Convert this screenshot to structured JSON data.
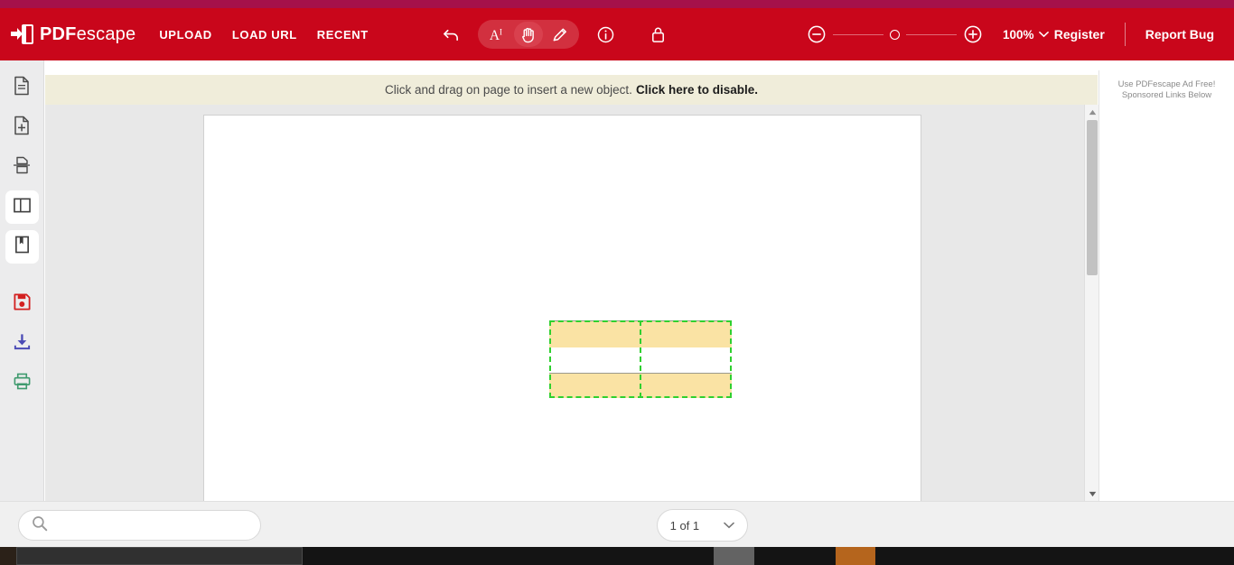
{
  "header": {
    "brand": {
      "pdf": "PDF",
      "escape": "escape",
      "icon": "pdfescape-logo-icon"
    },
    "nav": [
      {
        "label": "UPLOAD",
        "name": "nav-upload"
      },
      {
        "label": "LOAD URL",
        "name": "nav-load-url"
      },
      {
        "label": "RECENT",
        "name": "nav-recent"
      }
    ],
    "tools": [
      {
        "name": "undo-icon",
        "title": "Undo",
        "active": false
      },
      {
        "name": "text-tool-icon",
        "title": "Text Tool",
        "active": false
      },
      {
        "name": "hand-tool-icon",
        "title": "Hand Tool",
        "active": true
      },
      {
        "name": "pencil-tool-icon",
        "title": "Draw Tool",
        "active": false
      },
      {
        "name": "info-icon",
        "title": "Info",
        "active": false
      },
      {
        "name": "lock-icon",
        "title": "Lock",
        "active": false
      }
    ],
    "zoom": {
      "minus_icon": "zoom-out-icon",
      "plus_icon": "zoom-in-icon",
      "level": "100%",
      "chevron": "chevron-down-icon"
    },
    "register_label": "Register",
    "report_bug_label": "Report Bug",
    "accent_color": "#c9061b",
    "top_strip_color": "#a5114a"
  },
  "sidebar": {
    "items": [
      {
        "name": "sidebar-page-view",
        "icon": "document-icon",
        "active": false
      },
      {
        "name": "sidebar-insert-page",
        "icon": "add-page-icon",
        "active": false
      },
      {
        "name": "sidebar-split-page",
        "icon": "split-page-icon",
        "active": false
      },
      {
        "name": "sidebar-panel-layout",
        "icon": "panel-layout-icon",
        "active": true
      },
      {
        "name": "sidebar-bookmarks",
        "icon": "bookmark-page-icon",
        "active": true
      }
    ],
    "actions": [
      {
        "name": "sidebar-save",
        "icon": "save-icon",
        "color": "#d32020"
      },
      {
        "name": "sidebar-download",
        "icon": "download-icon",
        "color": "#4a4ab5"
      },
      {
        "name": "sidebar-print",
        "icon": "printer-icon",
        "color": "#3f9a6e"
      }
    ]
  },
  "notice": {
    "text": "Click and drag on page to insert a new object.",
    "link": "Click here to disable.",
    "background": "#f0edda"
  },
  "document": {
    "page_background": "#ffffff",
    "object": {
      "type": "table",
      "rows": 3,
      "columns": 2,
      "selection_color": "#2fd02f",
      "row_fills": [
        "#fae3a4",
        "#ffffff",
        "#fae3a4"
      ],
      "border_color": "#9a9a8e"
    },
    "scrollbar": {
      "up_arrow": "scroll-up-arrow-icon",
      "down_arrow": "scroll-down-arrow-icon"
    }
  },
  "ad_panel": {
    "line1": "Use PDFescape Ad Free!",
    "line2": "Sponsored Links Below"
  },
  "bottom": {
    "search": {
      "placeholder": "",
      "value": "",
      "icon": "search-icon"
    },
    "page_nav": {
      "label": "1 of 1",
      "chevron": "chevron-down-icon"
    }
  }
}
